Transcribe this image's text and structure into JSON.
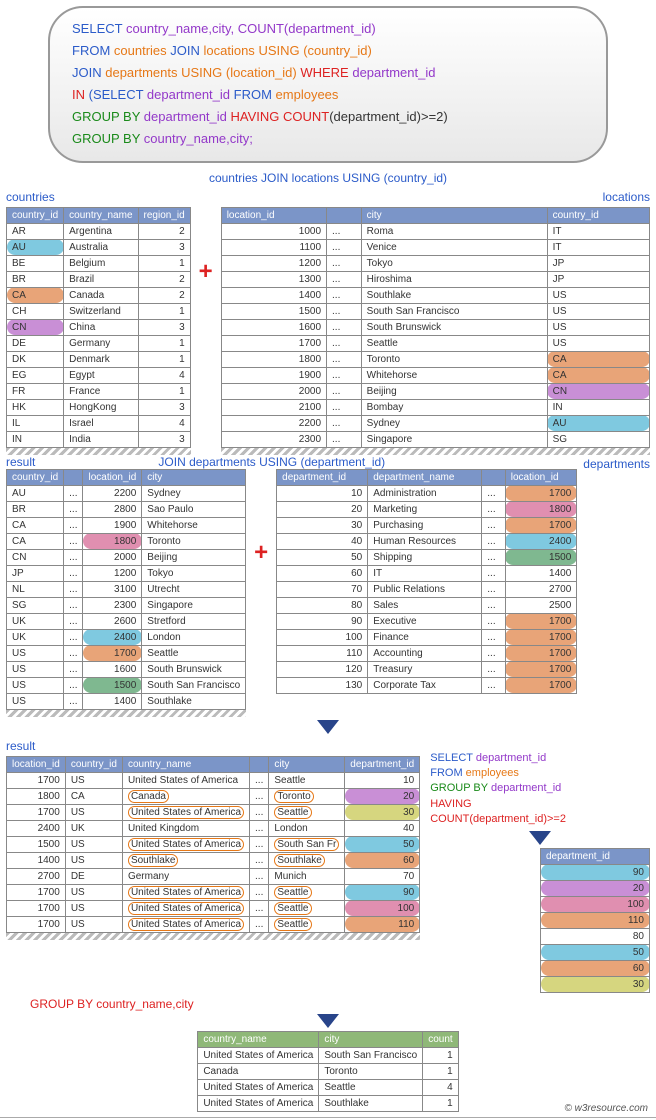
{
  "sql": {
    "l1a": "SELECT",
    "l1b": " country_name,city, COUNT(department_id)",
    "l2a": "FROM",
    "l2b": " countries ",
    "l2c": "JOIN",
    "l2d": " locations ",
    "l2e": "USING (country_id)",
    "l3a": "JOIN",
    "l3b": " departments ",
    "l3c": "USING (location_id) ",
    "l3d": "WHERE",
    "l3e": " department_id",
    "l4a": "IN ",
    "l4b": "(SELECT",
    "l4c": " department_id ",
    "l4d": "FROM",
    "l4e": " employees",
    "l5a": "GROUP BY",
    "l5b": " department_id ",
    "l5c": "HAVING COUNT",
    "l5d": "(department_id)>=2)",
    "l6a": "GROUP BY",
    "l6b": " country_name,city;"
  },
  "labels": {
    "step1": "countries JOIN locations USING (country_id)",
    "countries": "countries",
    "locations": "locations",
    "result": "result",
    "step2": "JOIN departments USING (department_id)",
    "departments": "departments",
    "groupby": "GROUP BY country_name,city"
  },
  "sub": {
    "l1": "SELECT ",
    "l1b": "department_id",
    "l2": "FROM ",
    "l2b": "employees",
    "l3": "GROUP BY ",
    "l3b": "department_id",
    "l4": "HAVING",
    "l5": "COUNT(department_id)>=2"
  },
  "countries": {
    "h": [
      "country_id",
      "country_name",
      "region_id"
    ],
    "rows": [
      [
        "AR",
        "Argentina",
        "2"
      ],
      [
        "AU",
        "Australia",
        "3"
      ],
      [
        "BE",
        "Belgium",
        "1"
      ],
      [
        "BR",
        "Brazil",
        "2"
      ],
      [
        "CA",
        "Canada",
        "2"
      ],
      [
        "CH",
        "Switzerland",
        "1"
      ],
      [
        "CN",
        "China",
        "3"
      ],
      [
        "DE",
        "Germany",
        "1"
      ],
      [
        "DK",
        "Denmark",
        "1"
      ],
      [
        "EG",
        "Egypt",
        "4"
      ],
      [
        "FR",
        "France",
        "1"
      ],
      [
        "HK",
        "HongKong",
        "3"
      ],
      [
        "IL",
        "Israel",
        "4"
      ],
      [
        "IN",
        "India",
        "3"
      ]
    ]
  },
  "locations": {
    "h": [
      "location_id",
      "",
      "city",
      "country_id"
    ],
    "rows": [
      [
        "1000",
        "...",
        "Roma",
        "IT"
      ],
      [
        "1100",
        "...",
        "Venice",
        "IT"
      ],
      [
        "1200",
        "...",
        "Tokyo",
        "JP"
      ],
      [
        "1300",
        "...",
        "Hiroshima",
        "JP"
      ],
      [
        "1400",
        "...",
        "Southlake",
        "US"
      ],
      [
        "1500",
        "...",
        "South San Francisco",
        "US"
      ],
      [
        "1600",
        "...",
        "South Brunswick",
        "US"
      ],
      [
        "1700",
        "...",
        "Seattle",
        "US"
      ],
      [
        "1800",
        "...",
        "Toronto",
        "CA"
      ],
      [
        "1900",
        "...",
        "Whitehorse",
        "CA"
      ],
      [
        "2000",
        "...",
        "Beijing",
        "CN"
      ],
      [
        "2100",
        "...",
        "Bombay",
        "IN"
      ],
      [
        "2200",
        "...",
        "Sydney",
        "AU"
      ],
      [
        "2300",
        "...",
        "Singapore",
        "SG"
      ]
    ]
  },
  "res1": {
    "h": [
      "country_id",
      "",
      "location_id",
      "city"
    ],
    "rows": [
      [
        "AU",
        "...",
        "2200",
        "Sydney"
      ],
      [
        "BR",
        "...",
        "2800",
        "Sao Paulo"
      ],
      [
        "CA",
        "...",
        "1900",
        "Whitehorse"
      ],
      [
        "CA",
        "...",
        "1800",
        "Toronto"
      ],
      [
        "CN",
        "...",
        "2000",
        "Beijing"
      ],
      [
        "JP",
        "...",
        "1200",
        "Tokyo"
      ],
      [
        "NL",
        "...",
        "3100",
        "Utrecht"
      ],
      [
        "SG",
        "...",
        "2300",
        "Singapore"
      ],
      [
        "UK",
        "...",
        "2600",
        "Stretford"
      ],
      [
        "UK",
        "...",
        "2400",
        "London"
      ],
      [
        "US",
        "...",
        "1700",
        "Seattle"
      ],
      [
        "US",
        "...",
        "1600",
        "South Brunswick"
      ],
      [
        "US",
        "...",
        "1500",
        "South San Francisco"
      ],
      [
        "US",
        "...",
        "1400",
        "Southlake"
      ]
    ]
  },
  "depts": {
    "h": [
      "department_id",
      "department_name",
      "",
      "location_id"
    ],
    "rows": [
      [
        "10",
        "Administration",
        "...",
        "1700"
      ],
      [
        "20",
        "Marketing",
        "...",
        "1800"
      ],
      [
        "30",
        "Purchasing",
        "...",
        "1700"
      ],
      [
        "40",
        "Human Resources",
        "...",
        "2400"
      ],
      [
        "50",
        "Shipping",
        "...",
        "1500"
      ],
      [
        "60",
        "IT",
        "...",
        "1400"
      ],
      [
        "70",
        "Public Relations",
        "...",
        "2700"
      ],
      [
        "80",
        "Sales",
        "...",
        "2500"
      ],
      [
        "90",
        "Executive",
        "...",
        "1700"
      ],
      [
        "100",
        "Finance",
        "...",
        "1700"
      ],
      [
        "110",
        "Accounting",
        "...",
        "1700"
      ],
      [
        "120",
        "Treasury",
        "...",
        "1700"
      ],
      [
        "130",
        "Corporate Tax",
        "...",
        "1700"
      ]
    ]
  },
  "res2": {
    "h": [
      "location_id",
      "country_id",
      "country_name",
      "",
      "city",
      "department_id"
    ],
    "rows": [
      [
        "1700",
        "US",
        "United States of America",
        "...",
        "Seattle",
        "10"
      ],
      [
        "1800",
        "CA",
        "Canada",
        "...",
        "Toronto",
        "20"
      ],
      [
        "1700",
        "US",
        "United States of America",
        "...",
        "Seattle",
        "30"
      ],
      [
        "2400",
        "UK",
        "United Kingdom",
        "...",
        "London",
        "40"
      ],
      [
        "1500",
        "US",
        "United States of America",
        "...",
        "South San Fr",
        "50"
      ],
      [
        "1400",
        "US",
        "Southlake",
        "...",
        "Southlake",
        "60"
      ],
      [
        "2700",
        "DE",
        "Germany",
        "...",
        "Munich",
        "70"
      ],
      [
        "1700",
        "US",
        "United States of America",
        "...",
        "Seattle",
        "90"
      ],
      [
        "1700",
        "US",
        "United States of America",
        "...",
        "Seattle",
        "100"
      ],
      [
        "1700",
        "US",
        "United States of America",
        "...",
        "Seattle",
        "110"
      ]
    ]
  },
  "deptids": {
    "h": [
      "department_id"
    ],
    "rows": [
      [
        "90"
      ],
      [
        "20"
      ],
      [
        "100"
      ],
      [
        "110"
      ],
      [
        "80"
      ],
      [
        "50"
      ],
      [
        "60"
      ],
      [
        "30"
      ]
    ]
  },
  "final": {
    "h": [
      "country_name",
      "city",
      "count"
    ],
    "rows": [
      [
        "United States of America",
        "South San Francisco",
        "1"
      ],
      [
        "Canada",
        "Toronto",
        "1"
      ],
      [
        "United States of America",
        "Seattle",
        "4"
      ],
      [
        "United States of America",
        "Southlake",
        "1"
      ]
    ]
  },
  "footer": "© w3resource.com"
}
